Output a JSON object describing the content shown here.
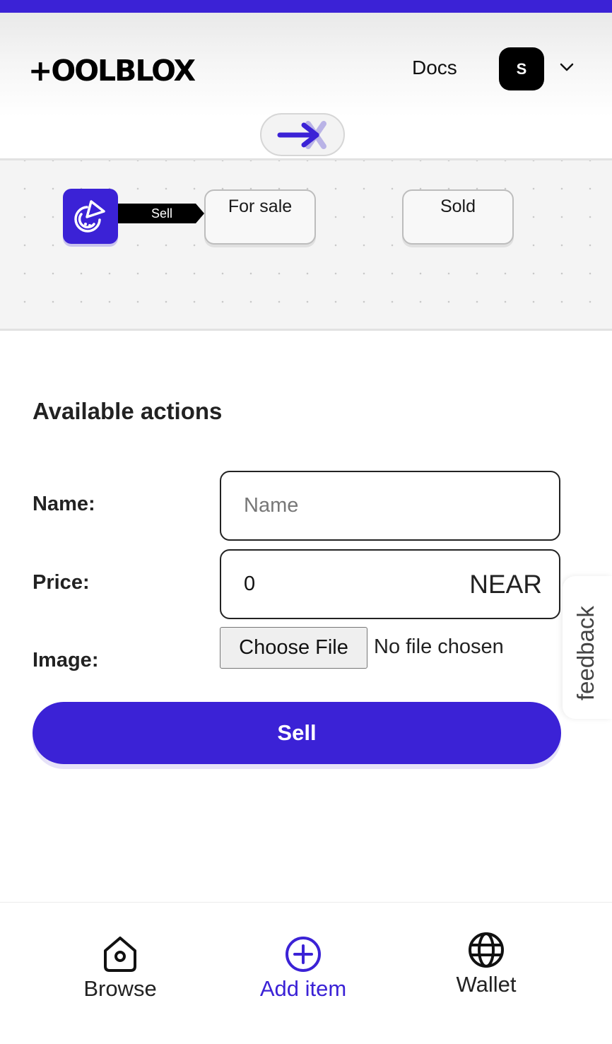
{
  "header": {
    "logo_text": "+OOLBLOX",
    "docs_label": "Docs",
    "avatar_initial": "S"
  },
  "flow": {
    "action_label": "Sell",
    "states": [
      "For sale",
      "Sold"
    ]
  },
  "form": {
    "title": "Available actions",
    "name_label": "Name:",
    "name_placeholder": "Name",
    "price_label": "Price:",
    "price_value": "0",
    "price_unit": "NEAR",
    "image_label": "Image:",
    "file_button": "Choose File",
    "file_status": "No file chosen",
    "submit_label": "Sell"
  },
  "feedback_label": "feedback",
  "nav": {
    "items": [
      {
        "label": "Browse",
        "icon": "home-icon"
      },
      {
        "label": "Add item",
        "icon": "plus-circle-icon"
      },
      {
        "label": "Wallet",
        "icon": "globe-icon"
      }
    ]
  },
  "colors": {
    "accent": "#3b22d6",
    "canvas_bg": "#f4f4f4"
  }
}
